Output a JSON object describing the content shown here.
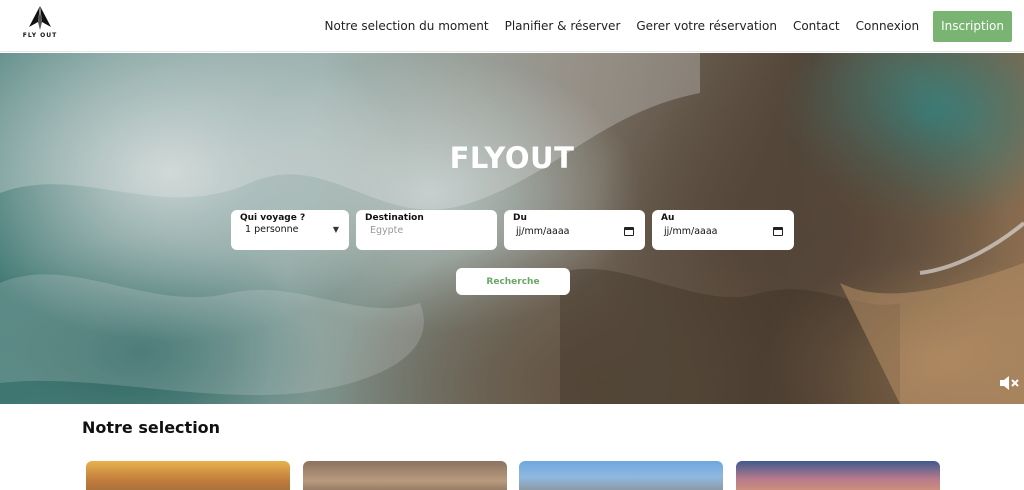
{
  "header": {
    "logo_text": "FLY OUT",
    "nav": [
      {
        "label": "Notre selection du moment"
      },
      {
        "label": "Planifier & réserver"
      },
      {
        "label": "Gerer votre réservation"
      },
      {
        "label": "Contact"
      },
      {
        "label": "Connexion"
      }
    ],
    "cta_label": "Inscription",
    "cta_color": "#79b473"
  },
  "hero": {
    "title": "FLYOUT",
    "travelers": {
      "label": "Qui voyage ?",
      "value": "1 personne"
    },
    "destination": {
      "label": "Destination",
      "placeholder": "Egypte"
    },
    "from": {
      "label": "Du",
      "value": "jj/mm/aaaa"
    },
    "to": {
      "label": "Au",
      "value": "jj/mm/aaaa"
    },
    "search_label": "Recherche"
  },
  "selection": {
    "title": "Notre selection"
  },
  "icons": {
    "logo": "paper-plane-icon",
    "select": "chevron-down-icon",
    "calendar": "calendar-icon",
    "mute": "speaker-muted-icon"
  }
}
